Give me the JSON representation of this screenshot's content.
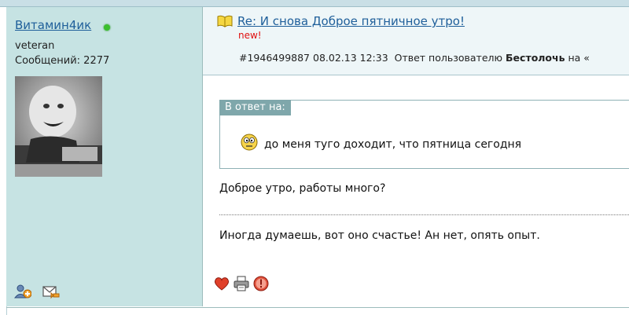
{
  "user": {
    "name": "Витамин4ик",
    "rank": "veteran",
    "posts_label": "Сообщений:",
    "posts_count": "2277",
    "online": true
  },
  "post": {
    "title": "Re: И снова Доброе пятничное утро!",
    "new_badge": "new!",
    "id": "#1946499887",
    "datetime": "08.02.13 12:33",
    "reply_to_label": "Ответ пользователю",
    "reply_to_user": "Бестолочь",
    "reply_to_suffix": "на «"
  },
  "quote": {
    "label": "В ответ на:",
    "text": "до меня туго доходит, что пятница сегодня"
  },
  "body": {
    "line1": "Доброе утро, работы много?",
    "line2": "Иногда думаешь, вот оно счастье! Ан нет, опять опыт."
  },
  "icons": {
    "online": "online-status-dot",
    "add_friend": "add-friend-icon",
    "message": "private-message-icon",
    "book": "book-icon",
    "smiley": "smiley-icon",
    "like": "heart-icon",
    "print": "printer-icon",
    "report": "warning-icon"
  },
  "colors": {
    "sidebar_bg": "#c6e3e3",
    "link": "#1f5f9a",
    "new_badge": "#e01010",
    "quote_label_bg": "#7fa7ab",
    "online": "#3bbf2e"
  }
}
